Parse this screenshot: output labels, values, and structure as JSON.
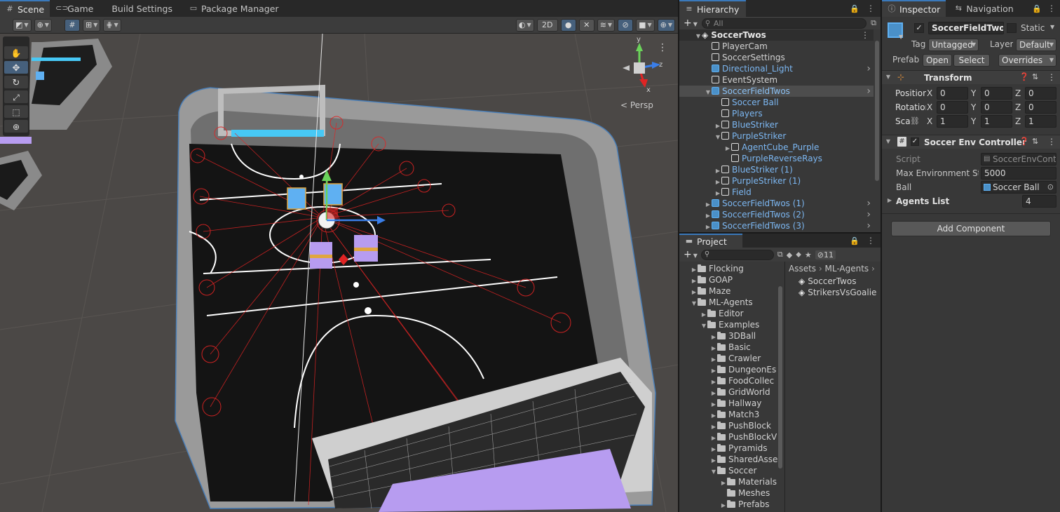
{
  "scene_tabs": [
    {
      "label": "Scene",
      "icon": "grid-icon"
    },
    {
      "label": "Game",
      "icon": "gamepad-icon"
    },
    {
      "label": "Build Settings",
      "icon": ""
    },
    {
      "label": "Package Manager",
      "icon": "package-icon"
    }
  ],
  "scene_toolbar": {
    "mode_2d": "2D",
    "persp_label": "< Persp"
  },
  "gizmo_axes": {
    "x": "x",
    "y": "y",
    "z": "z"
  },
  "hierarchy": {
    "tab_label": "Hierarchy",
    "search_placeholder": "All",
    "items": [
      {
        "label": "SoccerTwos",
        "depth": 0,
        "icon": "unity-logo-icon",
        "expand": "down",
        "style": "scene"
      },
      {
        "label": "PlayerCam",
        "depth": 1,
        "icon": "gameobject-icon",
        "expand": "",
        "style": "normal"
      },
      {
        "label": "SoccerSettings",
        "depth": 1,
        "icon": "gameobject-icon",
        "expand": "",
        "style": "normal"
      },
      {
        "label": "Directional_Light",
        "depth": 1,
        "icon": "prefab-icon",
        "expand": "",
        "style": "prefab",
        "arrow": true
      },
      {
        "label": "EventSystem",
        "depth": 1,
        "icon": "gameobject-icon",
        "expand": "",
        "style": "normal"
      },
      {
        "label": "SoccerFieldTwos",
        "depth": 1,
        "icon": "prefab-icon",
        "expand": "down",
        "style": "selected",
        "arrow": true
      },
      {
        "label": "Soccer Ball",
        "depth": 2,
        "icon": "gameobject-icon",
        "expand": "",
        "style": "prefab"
      },
      {
        "label": "Players",
        "depth": 2,
        "icon": "gameobject-icon",
        "expand": "",
        "style": "prefab"
      },
      {
        "label": "BlueStriker",
        "depth": 2,
        "icon": "gameobject-icon",
        "expand": "right",
        "style": "prefab"
      },
      {
        "label": "PurpleStriker",
        "depth": 2,
        "icon": "gameobject-icon",
        "expand": "down",
        "style": "prefab"
      },
      {
        "label": "AgentCube_Purple",
        "depth": 3,
        "icon": "gameobject-icon",
        "expand": "right",
        "style": "prefab"
      },
      {
        "label": "PurpleReverseRays",
        "depth": 3,
        "icon": "gameobject-icon",
        "expand": "",
        "style": "prefab"
      },
      {
        "label": "BlueStriker (1)",
        "depth": 2,
        "icon": "gameobject-icon",
        "expand": "right",
        "style": "prefab"
      },
      {
        "label": "PurpleStriker (1)",
        "depth": 2,
        "icon": "gameobject-icon",
        "expand": "right",
        "style": "prefab"
      },
      {
        "label": "Field",
        "depth": 2,
        "icon": "gameobject-icon",
        "expand": "right",
        "style": "prefab"
      },
      {
        "label": "SoccerFieldTwos (1)",
        "depth": 1,
        "icon": "prefab-icon",
        "expand": "right",
        "style": "prefab",
        "arrow": true
      },
      {
        "label": "SoccerFieldTwos (2)",
        "depth": 1,
        "icon": "prefab-icon",
        "expand": "right",
        "style": "prefab",
        "arrow": true
      },
      {
        "label": "SoccerFieldTwos (3)",
        "depth": 1,
        "icon": "prefab-icon",
        "expand": "right",
        "style": "prefab",
        "arrow": true
      }
    ]
  },
  "project": {
    "tab_label": "Project",
    "hidden_count": "11",
    "breadcrumb": [
      "Assets",
      "ML-Agents"
    ],
    "tree": [
      {
        "label": "Flocking",
        "depth": 1,
        "expand": "right"
      },
      {
        "label": "GOAP",
        "depth": 1,
        "expand": "right"
      },
      {
        "label": "Maze",
        "depth": 1,
        "expand": "right"
      },
      {
        "label": "ML-Agents",
        "depth": 1,
        "expand": "down"
      },
      {
        "label": "Editor",
        "depth": 2,
        "expand": "right"
      },
      {
        "label": "Examples",
        "depth": 2,
        "expand": "down"
      },
      {
        "label": "3DBall",
        "depth": 3,
        "expand": "right"
      },
      {
        "label": "Basic",
        "depth": 3,
        "expand": "right"
      },
      {
        "label": "Crawler",
        "depth": 3,
        "expand": "right"
      },
      {
        "label": "DungeonEs",
        "depth": 3,
        "expand": "right"
      },
      {
        "label": "FoodCollec",
        "depth": 3,
        "expand": "right"
      },
      {
        "label": "GridWorld",
        "depth": 3,
        "expand": "right"
      },
      {
        "label": "Hallway",
        "depth": 3,
        "expand": "right"
      },
      {
        "label": "Match3",
        "depth": 3,
        "expand": "right"
      },
      {
        "label": "PushBlock",
        "depth": 3,
        "expand": "right"
      },
      {
        "label": "PushBlockV",
        "depth": 3,
        "expand": "right"
      },
      {
        "label": "Pyramids",
        "depth": 3,
        "expand": "right"
      },
      {
        "label": "SharedAsse",
        "depth": 3,
        "expand": "right"
      },
      {
        "label": "Soccer",
        "depth": 3,
        "expand": "down"
      },
      {
        "label": "Materials",
        "depth": 4,
        "expand": "right"
      },
      {
        "label": "Meshes",
        "depth": 4,
        "expand": ""
      },
      {
        "label": "Prefabs",
        "depth": 4,
        "expand": "right"
      }
    ],
    "assets": [
      {
        "label": "SoccerTwos",
        "icon": "unity-scene-icon"
      },
      {
        "label": "StrikersVsGoalie",
        "icon": "unity-scene-icon"
      }
    ]
  },
  "inspector": {
    "tabs": [
      "Inspector",
      "Navigation"
    ],
    "object_name": "SoccerFieldTwos",
    "static_label": "Static",
    "tag_label": "Tag",
    "tag_value": "Untagged",
    "layer_label": "Layer",
    "layer_value": "Default",
    "prefab_label": "Prefab",
    "open_btn": "Open",
    "select_btn": "Select",
    "overrides_btn": "Overrides",
    "transform": {
      "title": "Transform",
      "position_label": "Position",
      "rotation_label": "Rotation",
      "scale_label": "Scale",
      "position": [
        "0",
        "0",
        "0"
      ],
      "rotation": [
        "0",
        "0",
        "0"
      ],
      "scale": [
        "1",
        "1",
        "1"
      ],
      "axes": [
        "X",
        "Y",
        "Z"
      ]
    },
    "soccer_env": {
      "title": "Soccer Env Controller",
      "script_label": "Script",
      "script_value": "SoccerEnvController",
      "max_env_label": "Max Environment Steps",
      "max_env_value": "5000",
      "ball_label": "Ball",
      "ball_value": "Soccer Ball",
      "agents_label": "Agents List",
      "agents_value": "4"
    },
    "add_component": "Add Component"
  },
  "colors": {
    "accent": "#3a79bb",
    "selection": "#4d4d4d",
    "prefab_text": "#7cb7f2",
    "red_rays": "#e02424",
    "field_black": "#141414",
    "purple": "#b79cf0",
    "cyan": "#47c8f5"
  }
}
